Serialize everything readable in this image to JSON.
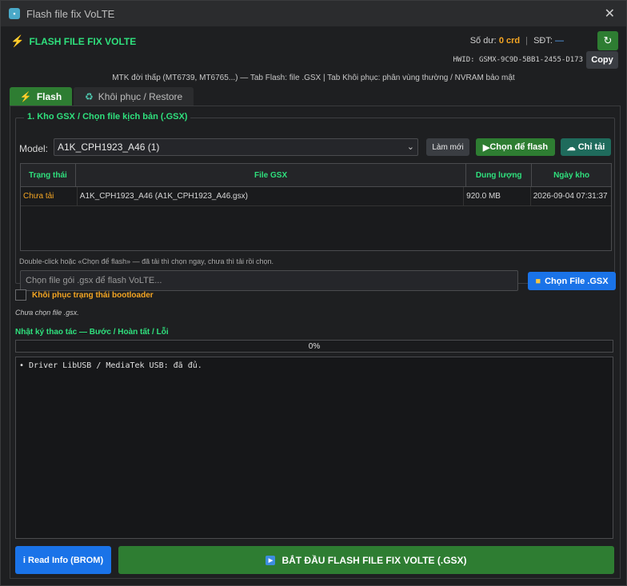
{
  "window": {
    "title": "Flash file fix VoLTE",
    "close_glyph": "✕"
  },
  "header": {
    "brand": "FLASH FILE FIX VOLTE",
    "balance_label": "Số dư:",
    "balance_value": "0 crd",
    "phone_label": "SĐT:",
    "phone_value": "—",
    "hwid": "HWID: GSMX-9C9D-5BB1-2455-D173",
    "copy_label": "Copy"
  },
  "info_line": "MTK đời thấp (MT6739, MT6765...) — Tab Flash: file .GSX  |  Tab Khôi phục: phân vùng thường / NVRAM bảo mật",
  "tabs": [
    {
      "label": "Flash",
      "icon": "bolt-icon"
    },
    {
      "label": "Khôi phục / Restore",
      "icon": "recycle-icon"
    }
  ],
  "repo": {
    "title": "1. Kho GSX / Chọn file kịch bản (.GSX)",
    "model_label": "Model:",
    "model_value": "A1K_CPH1923_A46 (1)",
    "refresh_label": "Làm mới",
    "choose_label": "Chọn để flash",
    "download_label": "Chỉ tải",
    "columns": [
      "Trạng thái",
      "File GSX",
      "Dung lượng",
      "Ngày kho"
    ],
    "rows": [
      {
        "status": "Chưa tải",
        "file": "A1K_CPH1923_A46 (A1K_CPH1923_A46.gsx)",
        "size": "920.0 MB",
        "date": "2026-09-04 07:31:37"
      }
    ],
    "hint": "Double-click hoặc «Chọn để flash» — đã tải thì chọn ngay, chưa thì tải rồi chọn.",
    "file_placeholder": "Chọn file gói .gsx để flash VoLTE...",
    "file_button": "Chọn File .GSX"
  },
  "bootloader_label": "Khôi phục trạng thái bootloader",
  "no_file_text": "Chưa chọn file .gsx.",
  "log": {
    "title": "Nhật ký thao tác — Bước / Hoàn tất / Lỗi",
    "progress": 0,
    "progress_text": "0%",
    "lines": [
      "• Driver LibUSB / MediaTek USB: đã đủ."
    ]
  },
  "actions": {
    "read_info": "Read Info (BROM)",
    "start": "BẮT ĐẦU FLASH FILE FIX VOLTE (.GSX)"
  },
  "colors": {
    "accent_green": "#2e7d32",
    "brand_green": "#2fe07d",
    "orange": "#f5a623",
    "blue": "#1a73e8"
  }
}
